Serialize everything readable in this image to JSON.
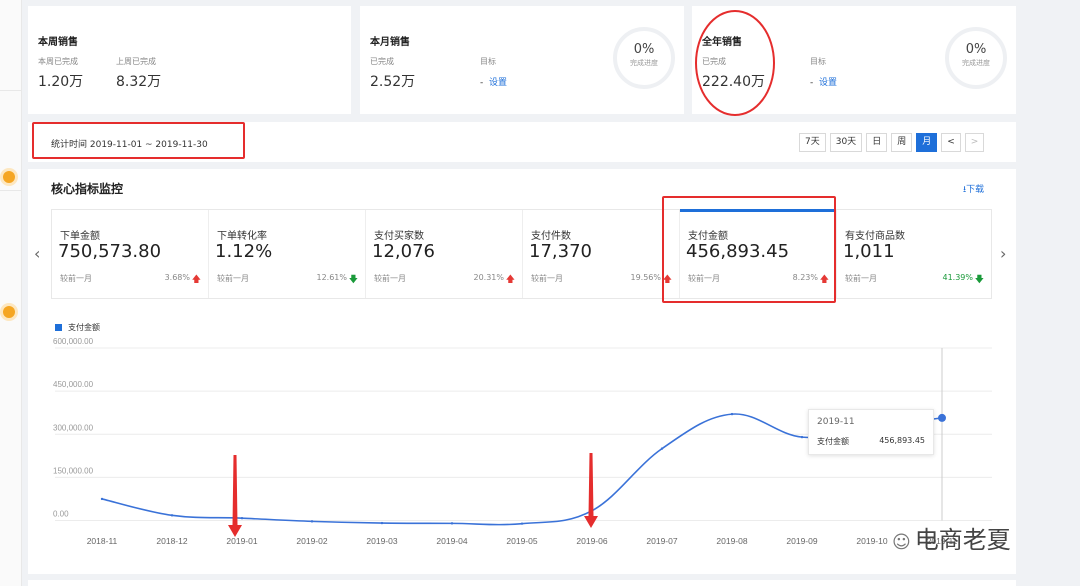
{
  "week_card": {
    "title": "本周销售",
    "done_label": "本周已完成",
    "done_value": "1.20万",
    "last_label": "上周已完成",
    "last_value": "8.32万"
  },
  "month_card": {
    "title": "本月销售",
    "done_label": "已完成",
    "done_value": "2.52万",
    "target_label": "目标",
    "target_dash": "-",
    "set_link": "设置",
    "progress": "0%",
    "progress_label": "完成进度"
  },
  "year_card": {
    "title": "全年销售",
    "done_label": "已完成",
    "done_value": "222.40万",
    "target_label": "目标",
    "target_dash": "-",
    "set_link": "设置",
    "progress": "0%",
    "progress_label": "完成进度"
  },
  "period": {
    "text": "统计时间 2019-11-01 ~ 2019-11-30"
  },
  "range_buttons": [
    "7天",
    "30天",
    "日",
    "周",
    "月",
    "<",
    ">"
  ],
  "section": {
    "title": "核心指标监控",
    "download": "下载"
  },
  "metrics": [
    {
      "name": "下单金额",
      "value": "750,573.80",
      "compare": "较前一月",
      "pct": "3.68%",
      "dir": "up"
    },
    {
      "name": "下单转化率",
      "value": "1.12%",
      "compare": "较前一月",
      "pct": "12.61%",
      "dir": "down"
    },
    {
      "name": "支付买家数",
      "value": "12,076",
      "compare": "较前一月",
      "pct": "20.31%",
      "dir": "up"
    },
    {
      "name": "支付件数",
      "value": "17,370",
      "compare": "较前一月",
      "pct": "19.56%",
      "dir": "up"
    },
    {
      "name": "支付金额",
      "value": "456,893.45",
      "compare": "较前一月",
      "pct": "8.23%",
      "dir": "up"
    },
    {
      "name": "有支付商品数",
      "value": "1,011",
      "compare": "较前一月",
      "pct": "41.39%",
      "dir": "down"
    }
  ],
  "colors": {
    "accent": "#1e6fd9",
    "up": "#e53935",
    "down": "#1a9a3a",
    "annotation": "#e52d2d"
  },
  "chart_data": {
    "type": "line",
    "series": [
      {
        "name": "支付金额",
        "values": [
          75000,
          18000,
          8000,
          -3000,
          -9000,
          -10000,
          -11000,
          34000,
          250000,
          370000,
          290000,
          325000,
          356893
        ]
      }
    ],
    "x": [
      "2018-11",
      "2018-12",
      "2019-01",
      "2019-02",
      "2019-03",
      "2019-04",
      "2019-05",
      "2019-06",
      "2019-07",
      "2019-08",
      "2019-09",
      "2019-10",
      "2019-11"
    ],
    "yticks": [
      "600,000.00",
      "450,000.00",
      "300,000.00",
      "150,000.00",
      "0.00"
    ],
    "ylim": [
      0,
      600000
    ],
    "legend": "top-left",
    "tooltip": {
      "date": "2019-11",
      "name": "支付金额",
      "value": "456,893.45"
    }
  },
  "watermark": "电商老夏"
}
